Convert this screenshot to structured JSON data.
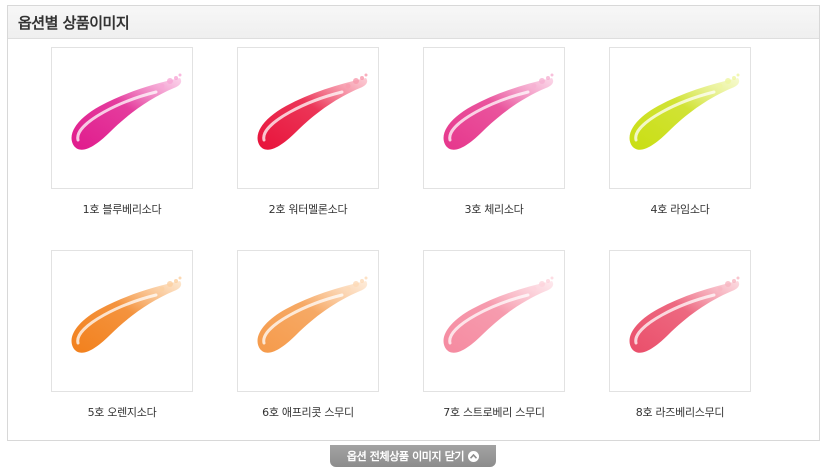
{
  "section": {
    "title": "옵션별 상품이미지"
  },
  "products": [
    {
      "label": "1호 블루베리소다",
      "color": "#e01a8c",
      "light": "#f7a6d6"
    },
    {
      "label": "2호 워터멜론소다",
      "color": "#e8123a",
      "light": "#f89aac"
    },
    {
      "label": "3호 체리소다",
      "color": "#e6368c",
      "light": "#f6b0d2"
    },
    {
      "label": "4호 라임소다",
      "color": "#c9de12",
      "light": "#eef5a0"
    },
    {
      "label": "5호 오렌지소다",
      "color": "#f2801c",
      "light": "#fbd0a0"
    },
    {
      "label": "6호 애프리콧 스무디",
      "color": "#f59a4a",
      "light": "#fcd9b6"
    },
    {
      "label": "7호 스트로베리 스무디",
      "color": "#f58aa0",
      "light": "#fcd3dc"
    },
    {
      "label": "8호 라즈베리스무디",
      "color": "#ea4e6a",
      "light": "#f8b6c2"
    }
  ],
  "footer": {
    "close_label": "옵션 전체상품 이미지 닫기"
  }
}
